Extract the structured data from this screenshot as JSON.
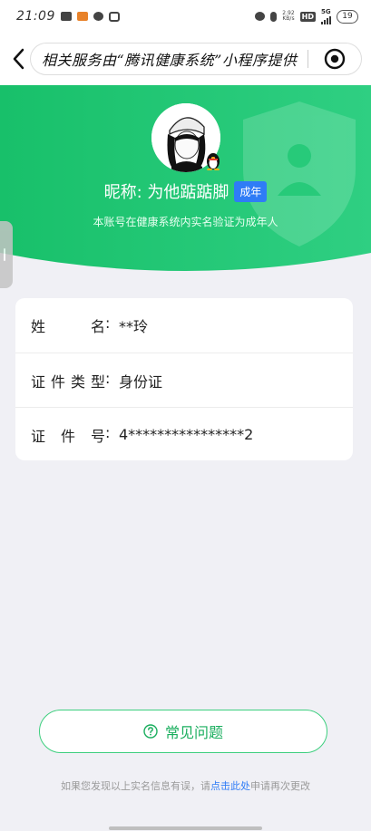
{
  "status_bar": {
    "time": "21:09",
    "net_speed_value": "2.92",
    "net_speed_unit": "KB/s",
    "hd_label": "HD",
    "network_label": "5G",
    "battery_level": "19"
  },
  "nav": {
    "notice": "相关服务由“腾讯健康系统”小程序提供"
  },
  "profile": {
    "nickname": "昵称: 为他踮踮脚",
    "adult_tag": "成年",
    "verify_note": "本账号在健康系统内实名验证为成年人"
  },
  "info": {
    "name_label_chars": [
      "姓",
      "名"
    ],
    "name_value": "**玲",
    "id_type_label_chars": [
      "证",
      "件",
      "类",
      "型"
    ],
    "id_type_value": "身份证",
    "id_no_label_chars": [
      "证",
      "件",
      "号"
    ],
    "id_no_value": "4****************2",
    "colon": ":"
  },
  "faq": {
    "label": "常见问题",
    "icon": "question-circle-icon"
  },
  "footer": {
    "prefix": "如果您发现以上实名信息有误，请",
    "link": "点击此处",
    "suffix": "申请再次更改"
  },
  "colors": {
    "accent_green": "#1aae5e",
    "hero_green": "#1fc46e",
    "tag_blue": "#2f7cf6"
  }
}
